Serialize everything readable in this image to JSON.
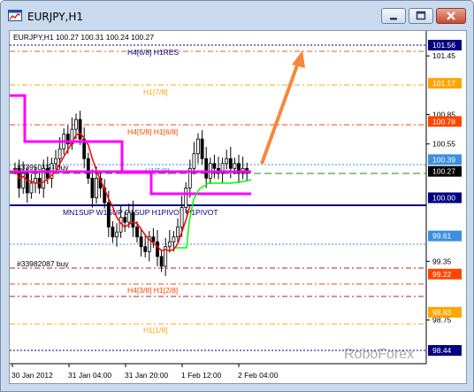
{
  "window": {
    "title": "EURJPY,H1"
  },
  "chart": {
    "header": "EURJPY,H1  100.27 100.31 100.24 100.27",
    "watermark": "RoboForex",
    "order_labels": [
      "#33950153 buy",
      "#33982087 buy"
    ],
    "pivot_caption": "MN1SUP W1SUP D1SUP H1PIVOT H1PIVOT",
    "level_labels": {
      "h4_68_h1res": "H4[6/8] H1RES",
      "h1_78": "H1[7/8]",
      "h4_58_h1_68": "H4[5/8] H1[6/8]",
      "h1_58": "H1[5/8]",
      "h4_38_h1_28": "H4[3/8] H1[2/8]",
      "h1_18": "H1[1/8]"
    },
    "x_labels": [
      "30 Jan 2012",
      "31 Jan 04:00",
      "31 Jan 20:00",
      "1 Feb 12:00",
      "2 Feb 04:00"
    ],
    "price_axis": {
      "ticks": [
        "101.45",
        "100.85",
        "100.55",
        "99.35",
        "98.75"
      ],
      "badges": [
        {
          "text": "101.56",
          "color": "#000080"
        },
        {
          "text": "101.17",
          "color": "#ffa500"
        },
        {
          "text": "100.78",
          "color": "#ff4500"
        },
        {
          "text": "100.39",
          "color": "#3d8fe0"
        },
        {
          "text": "100.27",
          "color": "#000000"
        },
        {
          "text": "100.00",
          "color": "#000080"
        },
        {
          "text": "99.61",
          "color": "#3d8fe0"
        },
        {
          "text": "99.22",
          "color": "#ff4500"
        },
        {
          "text": "98.83",
          "color": "#ffa500"
        },
        {
          "text": "98.44",
          "color": "#000080"
        }
      ]
    },
    "colors": {
      "candles": "#000000",
      "red_line": "#ff0000",
      "magenta_line": "#ff00ff",
      "green_line": "#00ff00",
      "arrow": "#f7873a"
    }
  },
  "chart_data": {
    "type": "candlestick",
    "symbol": "EURJPY",
    "timeframe": "H1",
    "ohlc_last": {
      "open": 100.27,
      "high": 100.31,
      "low": 100.24,
      "close": 100.27
    },
    "ylim": [
      98.44,
      101.62
    ],
    "close_series": [
      100.3,
      100.1,
      100.25,
      100.05,
      100.15,
      100.2,
      100.1,
      100.3,
      100.2,
      100.35,
      100.4,
      100.5,
      100.65,
      100.55,
      100.7,
      100.8,
      100.6,
      100.4,
      100.2,
      100.0,
      100.2,
      100.1,
      99.95,
      99.7,
      99.6,
      99.65,
      99.8,
      99.75,
      99.85,
      99.7,
      99.6,
      99.5,
      99.45,
      99.6,
      99.55,
      99.4,
      99.3,
      99.5,
      99.55,
      99.6,
      99.7,
      99.9,
      100.1,
      100.3,
      100.45,
      100.6,
      100.4,
      100.2,
      100.35,
      100.3,
      100.25,
      100.35,
      100.4,
      100.3,
      100.35,
      100.25,
      100.3,
      100.27
    ],
    "levels": [
      {
        "label": "H4[6/8] H1RES",
        "value": 101.56
      },
      {
        "label": "H1[7/8]",
        "value": 101.17
      },
      {
        "label": "H4[5/8] H1[6/8]",
        "value": 100.78
      },
      {
        "label": "H1[5/8]",
        "value": 100.39
      },
      {
        "label": "MN1SUP W1SUP D1SUP H1PIVOT H1PIVOT",
        "value": 100.0
      },
      {
        "label": "",
        "value": 99.61
      },
      {
        "label": "H4[3/8] H1[2/8]",
        "value": 99.22
      },
      {
        "label": "H1[1/8]",
        "value": 98.83
      },
      {
        "label": "",
        "value": 98.44
      }
    ]
  }
}
